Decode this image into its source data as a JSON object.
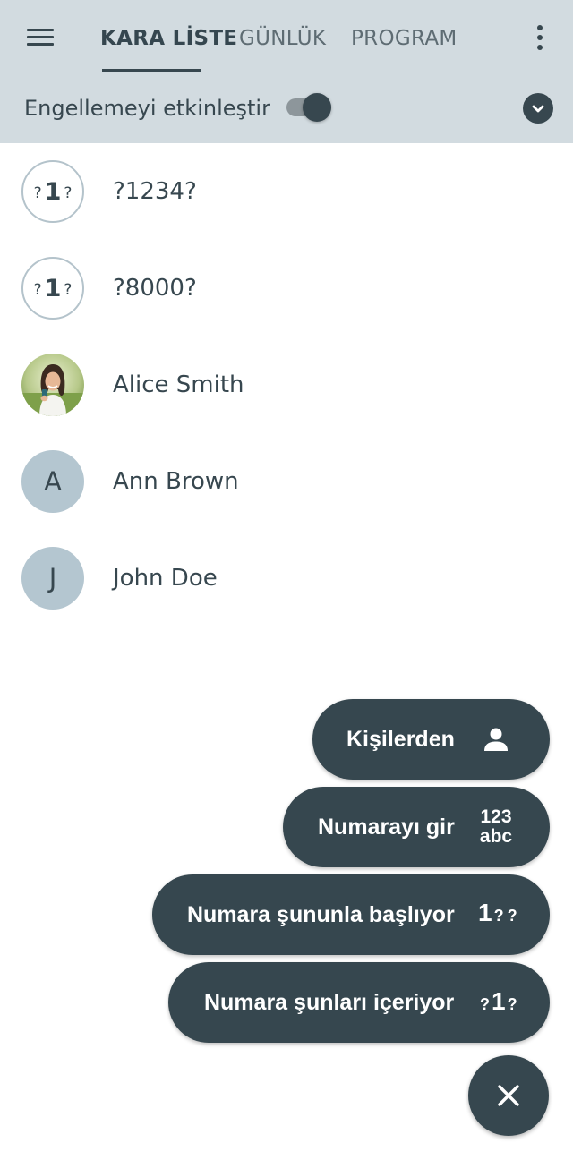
{
  "tabs": [
    {
      "label": "KARA LİSTE",
      "active": true
    },
    {
      "label": "GÜNLÜK",
      "active": false
    },
    {
      "label": "PROGRAM",
      "active": false
    }
  ],
  "block_toggle": {
    "label": "Engellemeyi etkinleştir",
    "enabled": true
  },
  "entries": [
    {
      "name": "?1234?",
      "avatar": "number-pattern",
      "glyph": "?1?"
    },
    {
      "name": "?8000?",
      "avatar": "number-pattern",
      "glyph": "?1?"
    },
    {
      "name": "Alice Smith",
      "avatar": "photo"
    },
    {
      "name": "Ann Brown",
      "avatar": "letter",
      "initial": "A"
    },
    {
      "name": "John Doe",
      "avatar": "letter",
      "initial": "J"
    }
  ],
  "fab_menu": {
    "items": [
      {
        "label": "Kişilerden",
        "icon": "person-icon"
      },
      {
        "label": "Numarayı gir",
        "icon": "keypad-text-icon",
        "icon_text_top": "123",
        "icon_text_bottom": "abc"
      },
      {
        "label": "Numara şununla başlıyor",
        "icon": "starts-with-icon"
      },
      {
        "label": "Numara şunları içeriyor",
        "icon": "contains-icon"
      }
    ],
    "close_icon": "close-icon"
  },
  "colors": {
    "header_bg": "#d2dbe0",
    "primary_dark": "#37474f",
    "fab_bg": "#36474f",
    "letter_avatar_bg": "#b4c6d0",
    "avatar_outline": "#b4c3cb"
  }
}
